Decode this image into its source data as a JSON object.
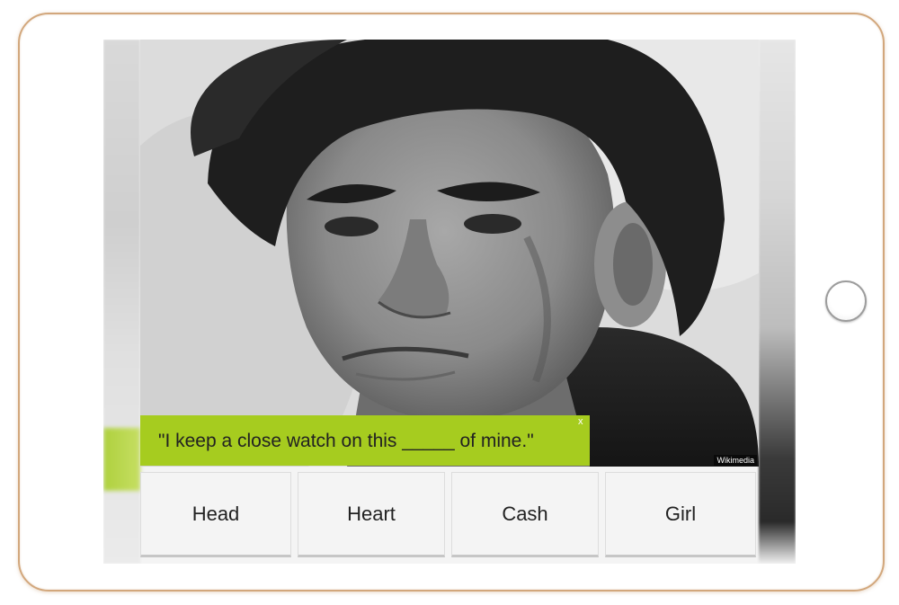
{
  "quiz": {
    "question": "\"I keep a close watch on this _____ of mine.\"",
    "close_glyph": "x",
    "photo_credit": "Wikimedia",
    "answers": [
      {
        "label": "Head"
      },
      {
        "label": "Heart"
      },
      {
        "label": "Cash"
      },
      {
        "label": "Girl"
      }
    ]
  },
  "colors": {
    "accent": "#a6cc1f",
    "tablet_frame": "#d2a77c",
    "answer_bg": "#f4f4f4"
  }
}
